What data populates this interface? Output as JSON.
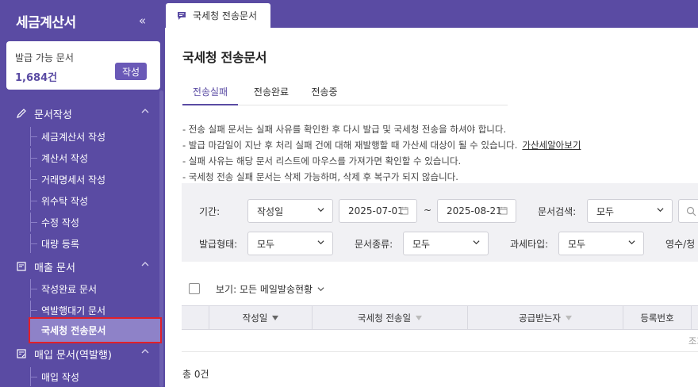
{
  "sidebar": {
    "title": "세금계산서",
    "collapse_icon": "«",
    "issue": {
      "label": "발급 가능 문서",
      "count": "1,684건",
      "button": "작성"
    },
    "sections": [
      {
        "label": "문서작성",
        "icon": "pencil-icon",
        "items": [
          "세금계산서 작성",
          "계산서 작성",
          "거래명세서 작성",
          "위수탁 작성",
          "수정 작성",
          "대량 등록"
        ]
      },
      {
        "label": "매출 문서",
        "icon": "document-icon",
        "items": [
          "작성완료 문서",
          "역발행대기 문서",
          "국세청 전송문서"
        ]
      },
      {
        "label": "매입 문서(역발행)",
        "icon": "document-in-icon",
        "items": [
          "매입 작성"
        ]
      }
    ],
    "active_item": "국세청 전송문서"
  },
  "topbar": {
    "tab_label": "국세청 전송문서",
    "tab_icon": "message-icon"
  },
  "page": {
    "title": "국세청 전송문서",
    "subtabs": [
      "전송실패",
      "전송완료",
      "전송중"
    ],
    "active_subtab": "전송실패",
    "notices": [
      "- 전송 실패 문서는 실패 사유를 확인한 후 다시 발급 및 국세청 전송을 하셔야 합니다.",
      "- 발급 마감일이 지난 후 처리 실패 건에 대해 재발행할 때 가산세 대상이 될 수 있습니다.",
      "- 실패 사유는 해당 문서 리스트에 마우스를 가져가면 확인할 수 있습니다.",
      "- 국세청 전송 실패 문서는 삭제 가능하며, 삭제 후 복구가 되지 않습니다."
    ],
    "notice_link": "가산세알아보기"
  },
  "filter": {
    "period_label": "기간:",
    "period_type": "작성일",
    "date_from": "2025-07-01",
    "date_sep": "~",
    "date_to": "2025-08-21",
    "search_label": "문서검색:",
    "search_value": "모두",
    "issue_type_label": "발급형태:",
    "issue_type_value": "모두",
    "doc_type_label": "문서종류:",
    "doc_type_value": "모두",
    "tax_type_label": "과세타입:",
    "tax_type_value": "모두",
    "receipt_label": "영수/청"
  },
  "table": {
    "view_label": "보기: 모든 메일발송현황",
    "headers": [
      "작성일",
      "국세청 전송일",
      "공급받는자",
      "등록번호"
    ],
    "empty_message": "조회"
  },
  "total": "총 0건",
  "colors": {
    "brand": "#5a4ba3",
    "active_bg": "#8e82c8",
    "highlight_border": "#e0202a"
  }
}
